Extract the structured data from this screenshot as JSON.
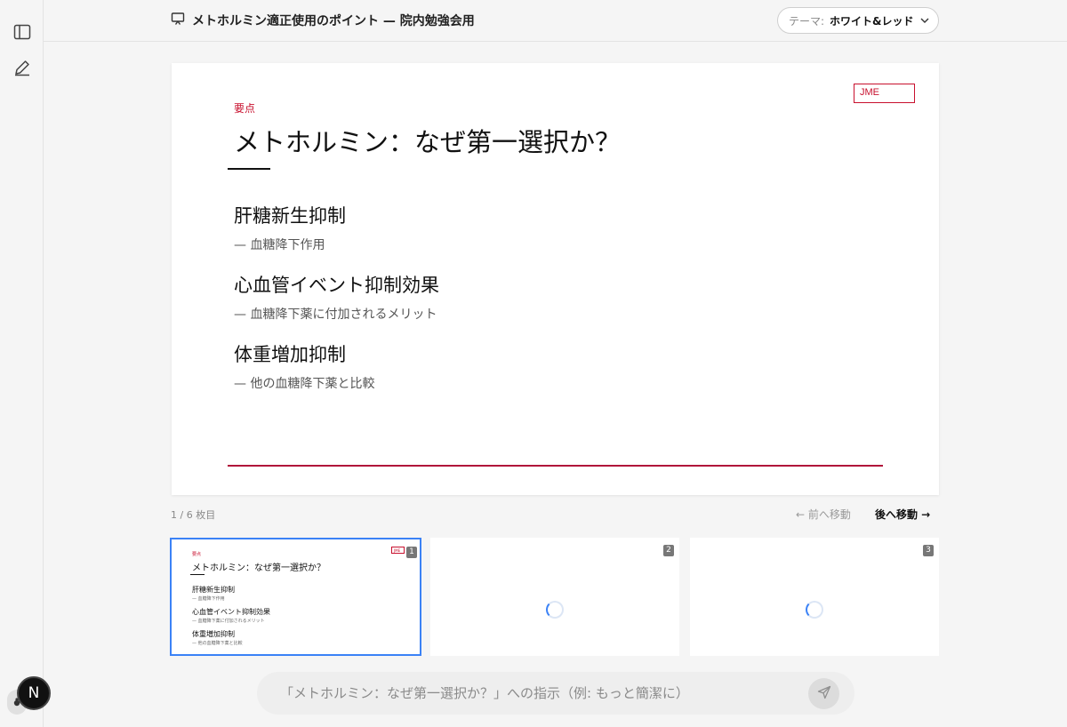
{
  "header": {
    "doc_title": "メトホルミン適正使用のポイント — 院内勉強会用",
    "theme_label": "テーマ:",
    "theme_value": "ホワイト&レッド"
  },
  "slide": {
    "logo": "JME",
    "eyebrow": "要点",
    "title": "メトホルミン：なぜ第一選択か？",
    "points": [
      {
        "heading": "肝糖新生抑制",
        "sub": "—  血糖降下作用"
      },
      {
        "heading": "心血管イベント抑制効果",
        "sub": "—  血糖降下薬に付加されるメリット"
      },
      {
        "heading": "体重増加抑制",
        "sub": "—  他の血糖降下薬と比較"
      }
    ],
    "accent_color": "#c8102e"
  },
  "pager": {
    "counter": "1 / 6 枚目",
    "prev": "← 前へ移動",
    "next": "後へ移動 →"
  },
  "thumbnails": [
    {
      "number": "1",
      "state": "loaded"
    },
    {
      "number": "2",
      "state": "loading"
    },
    {
      "number": "3",
      "state": "loading"
    }
  ],
  "prompt": {
    "placeholder": "「メトホルミン：なぜ第一選択か？」への指示（例: もっと簡潔に）"
  },
  "badge": {
    "letter": "N"
  }
}
